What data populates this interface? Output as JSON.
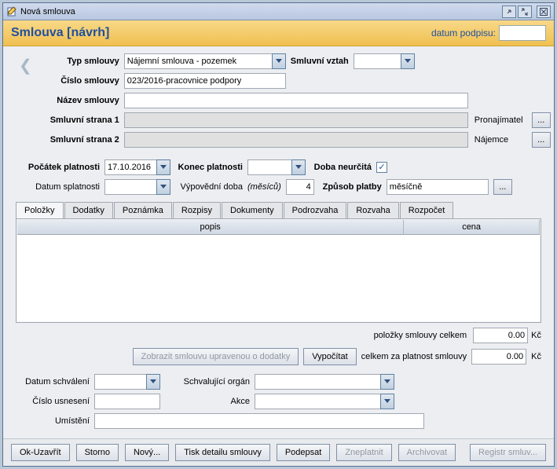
{
  "window": {
    "title": "Nová smlouva"
  },
  "header": {
    "title": "Smlouva [návrh]",
    "date_label": "datum podpisu:",
    "date_value": ""
  },
  "form": {
    "typ_smlouvy_label": "Typ smlouvy",
    "typ_smlouvy_value": "Nájemní smlouva - pozemek",
    "smluvni_vztah_label": "Smluvní vztah",
    "smluvni_vztah_value": "",
    "cislo_smlouvy_label": "Číslo smlouvy",
    "cislo_smlouvy_value": "023/2016-pracovnice podpory",
    "nazev_smlouvy_label": "Název smlouvy",
    "nazev_smlouvy_value": "",
    "strana1_label": "Smluvní strana 1",
    "strana1_value": "",
    "strana1_role": "Pronajímatel",
    "strana2_label": "Smluvní strana 2",
    "strana2_value": "",
    "strana2_role": "Nájemce",
    "pocatek_label": "Počátek platnosti",
    "pocatek_value": "17.10.2016",
    "konec_label": "Konec platnosti",
    "konec_value": "",
    "neurcita_label": "Doba neurčitá",
    "neurcita_checked": true,
    "splatnost_label": "Datum splatnosti",
    "splatnost_value": "",
    "vypovedni_label": "Výpovědní doba",
    "vypovedni_unit": "(měsíců)",
    "vypovedni_value": "4",
    "zpusob_label": "Způsob platby",
    "zpusob_value": "měsíčně"
  },
  "tabs": {
    "items": [
      "Položky",
      "Dodatky",
      "Poznámka",
      "Rozpisy",
      "Dokumenty",
      "Podrozvaha",
      "Rozvaha",
      "Rozpočet"
    ],
    "active": 0,
    "grid_headers": {
      "popis": "popis",
      "cena": "cena"
    }
  },
  "totals": {
    "items_label": "položky smlouvy celkem",
    "items_value": "0.00",
    "show_amend_btn": "Zobrazit smlouvu upravenou o dodatky",
    "calc_btn": "Vypočítat",
    "validity_label": "celkem za platnost smlouvy",
    "validity_value": "0.00",
    "currency": "Kč"
  },
  "approval": {
    "datum_label": "Datum schválení",
    "datum_value": "",
    "organ_label": "Schvalující orgán",
    "organ_value": "",
    "usneseni_label": "Číslo usnesení",
    "usneseni_value": "",
    "akce_label": "Akce",
    "akce_value": "",
    "umisteni_label": "Umístění",
    "umisteni_value": ""
  },
  "buttons": {
    "ok": "Ok-Uzavřít",
    "storno": "Storno",
    "novy": "Nový...",
    "tisk": "Tisk detailu smlouvy",
    "podepsat": "Podepsat",
    "zneplatnit": "Zneplatnit",
    "archivovat": "Archivovat",
    "registr": "Registr smluv..."
  },
  "icons": {
    "dots": "..."
  }
}
